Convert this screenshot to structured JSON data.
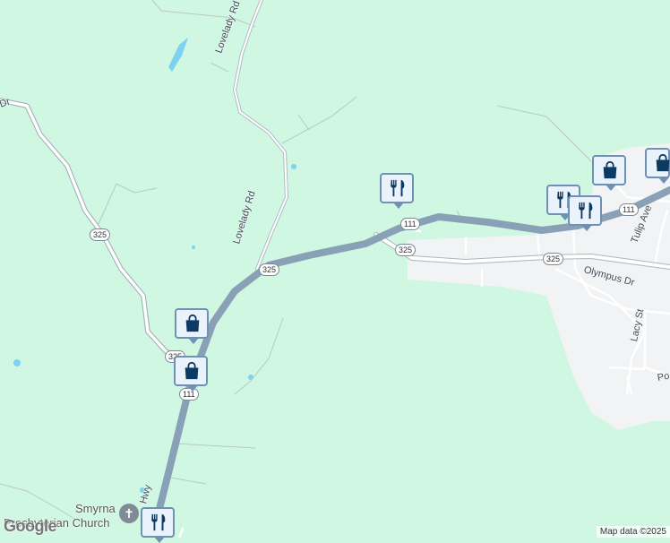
{
  "map": {
    "roads": {
      "lovelady": "Lovelady Rd",
      "tulip": "Tulip Ave",
      "olympus": "Olympus Dr",
      "lacy": "Lacy St",
      "dr_left": "Dr",
      "po": "Po",
      "hwy": "Hwy"
    },
    "shields": {
      "r325_a": "325",
      "r325_b": "325",
      "r325_c": "325",
      "r325_d": "325",
      "r325_e": "325",
      "r111_a": "111",
      "r111_b": "111",
      "r111_c": "111"
    },
    "poi": {
      "church_name_line1": "Smyrna",
      "church_name_line2": "Presbyterian Church"
    },
    "markers": [
      {
        "icon": "restaurant-icon"
      },
      {
        "icon": "restaurant-icon"
      },
      {
        "icon": "restaurant-icon"
      },
      {
        "icon": "restaurant-icon"
      },
      {
        "icon": "shopping-bag-icon"
      },
      {
        "icon": "shopping-bag-icon"
      },
      {
        "icon": "shopping-bag-icon"
      },
      {
        "icon": "shopping-bag-icon"
      }
    ],
    "colors": {
      "land": "#cff7e2",
      "urban": "#f1f3f4",
      "highway": "#8aa0b6",
      "water": "#7dd2f0",
      "marker_border": "#6f91b4",
      "marker_icon": "#0d3a63"
    }
  },
  "footer": {
    "logo": "Google",
    "attribution": "Map data ©2025"
  }
}
